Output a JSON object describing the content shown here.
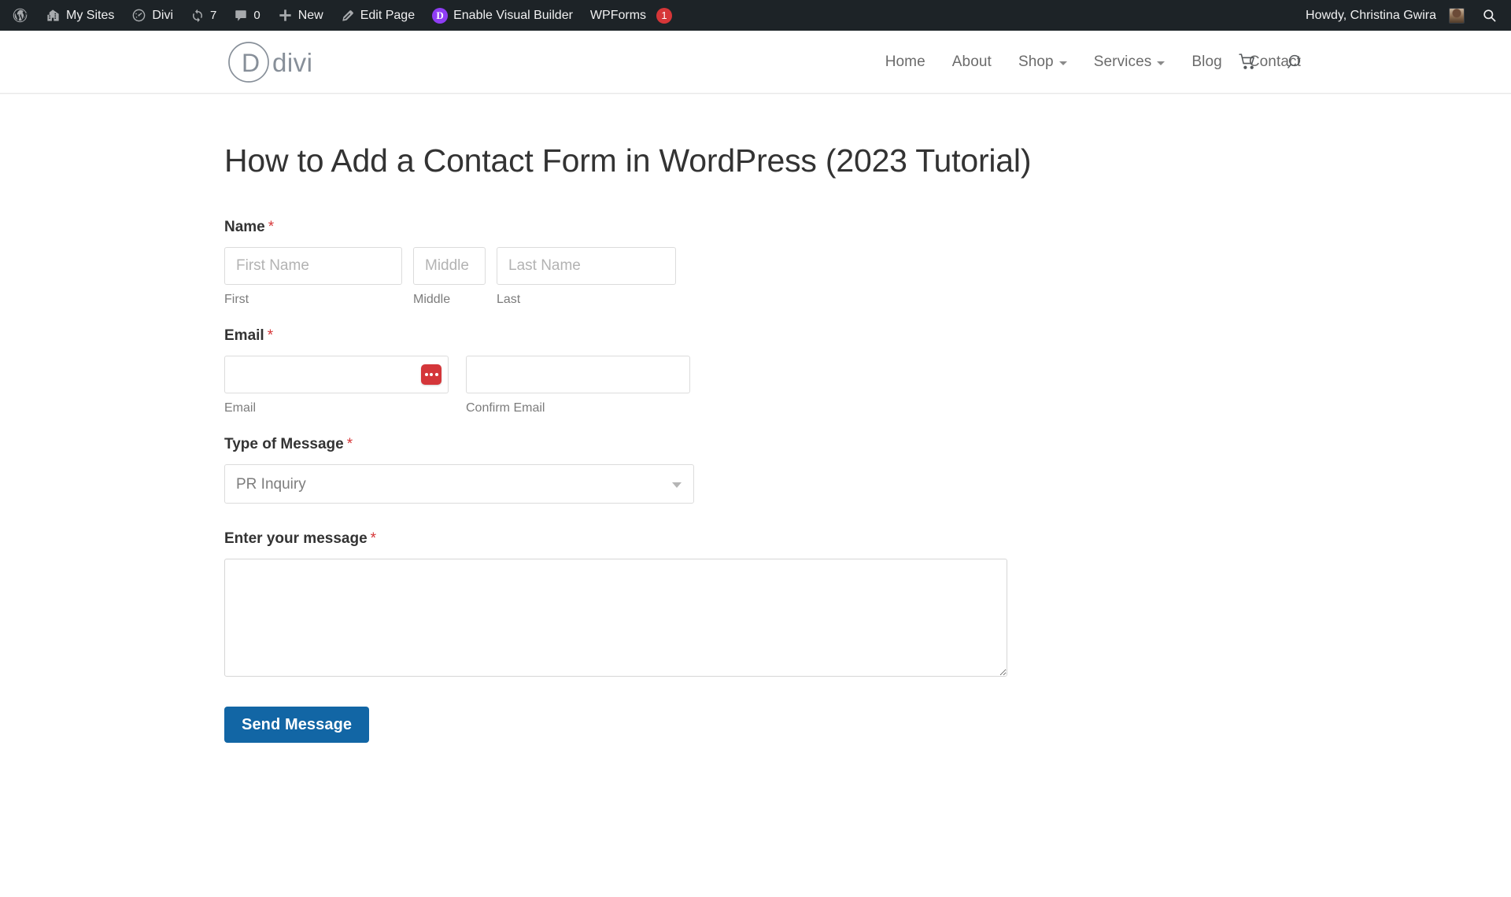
{
  "adminbar": {
    "left_items": [
      {
        "name": "wordpress-logo",
        "icon": "wordpress-icon",
        "label": ""
      },
      {
        "name": "my-sites",
        "icon": "buildings-icon",
        "label": "My Sites"
      },
      {
        "name": "divi",
        "icon": "gauge-icon",
        "label": "Divi"
      },
      {
        "name": "updates",
        "icon": "update-icon",
        "label": "7"
      },
      {
        "name": "comments",
        "icon": "comment-bubble-icon",
        "label": "0"
      },
      {
        "name": "new",
        "icon": "plus-icon",
        "label": "New"
      },
      {
        "name": "edit-page",
        "icon": "pencil-icon",
        "label": "Edit Page"
      },
      {
        "name": "enable-visual-builder",
        "icon": "divi-circle-icon",
        "label": "Enable Visual Builder"
      },
      {
        "name": "wpforms",
        "icon": "",
        "label": "WPForms",
        "count": "1"
      }
    ],
    "howdy": "Howdy, Christina Gwira",
    "search_icon": "search-icon"
  },
  "header": {
    "logo_text": "divi",
    "logo_monogram": "D",
    "nav": [
      {
        "label": "Home",
        "dropdown": false
      },
      {
        "label": "About",
        "dropdown": false
      },
      {
        "label": "Shop",
        "dropdown": true
      },
      {
        "label": "Services",
        "dropdown": true
      },
      {
        "label": "Blog",
        "dropdown": false
      },
      {
        "label": "Contact",
        "dropdown": false
      }
    ],
    "cart_icon": "cart-icon",
    "search_icon": "search-icon"
  },
  "page": {
    "title": "How to Add a Contact Form in WordPress (2023 Tutorial)"
  },
  "form": {
    "name": {
      "label": "Name",
      "required": "*",
      "first": {
        "placeholder": "First Name",
        "value": "",
        "sublabel": "First"
      },
      "middle": {
        "placeholder": "Middle",
        "value": "",
        "sublabel": "Middle"
      },
      "last": {
        "placeholder": "Last Name",
        "value": "",
        "sublabel": "Last"
      }
    },
    "email": {
      "label": "Email",
      "required": "*",
      "email": {
        "placeholder": "",
        "value": "",
        "sublabel": "Email"
      },
      "confirm": {
        "placeholder": "",
        "value": "",
        "sublabel": "Confirm Email"
      },
      "autofill_icon": "lastpass-autofill-icon"
    },
    "type_of_message": {
      "label": "Type of Message",
      "required": "*",
      "selected": "PR Inquiry",
      "options": [
        "PR Inquiry"
      ]
    },
    "message": {
      "label": "Enter your message",
      "required": "*",
      "placeholder": "",
      "value": ""
    },
    "submit_label": "Send Message"
  },
  "colors": {
    "adminbar_bg": "#1d2327",
    "accent_button": "#1266a5",
    "required_star": "#d63638",
    "badge_red": "#d63638",
    "divi_purple": "#8f3df5",
    "lastpass_red": "#d4363a"
  }
}
